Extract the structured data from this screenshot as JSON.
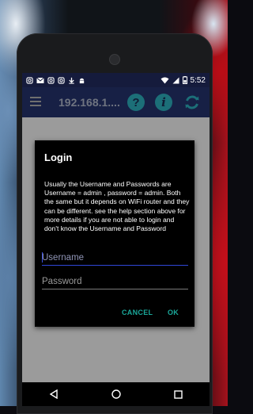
{
  "status_bar": {
    "notification_icons": [
      "instagram-icon",
      "mail-icon",
      "instagram-icon",
      "instagram-icon",
      "download-icon",
      "android-icon"
    ],
    "time": "5:52"
  },
  "app_bar": {
    "title": "192.168.1....",
    "help_icon": "?",
    "info_icon": "i",
    "accent_color": "#1c6f78"
  },
  "dialog": {
    "title": "Login",
    "message": "Usually the Username and Passwords are Username = admin , password = admin. Both the same but it depends on WiFi router and they can be different. see the help section above for more details if you are not able to login and don't know the Username and Password",
    "username_placeholder": "Username",
    "password_placeholder": "Password",
    "cancel_label": "CANCEL",
    "ok_label": "OK",
    "button_color": "#1aa89a"
  },
  "nav_bar": {
    "buttons": [
      "back-icon",
      "home-icon",
      "recents-icon"
    ]
  }
}
